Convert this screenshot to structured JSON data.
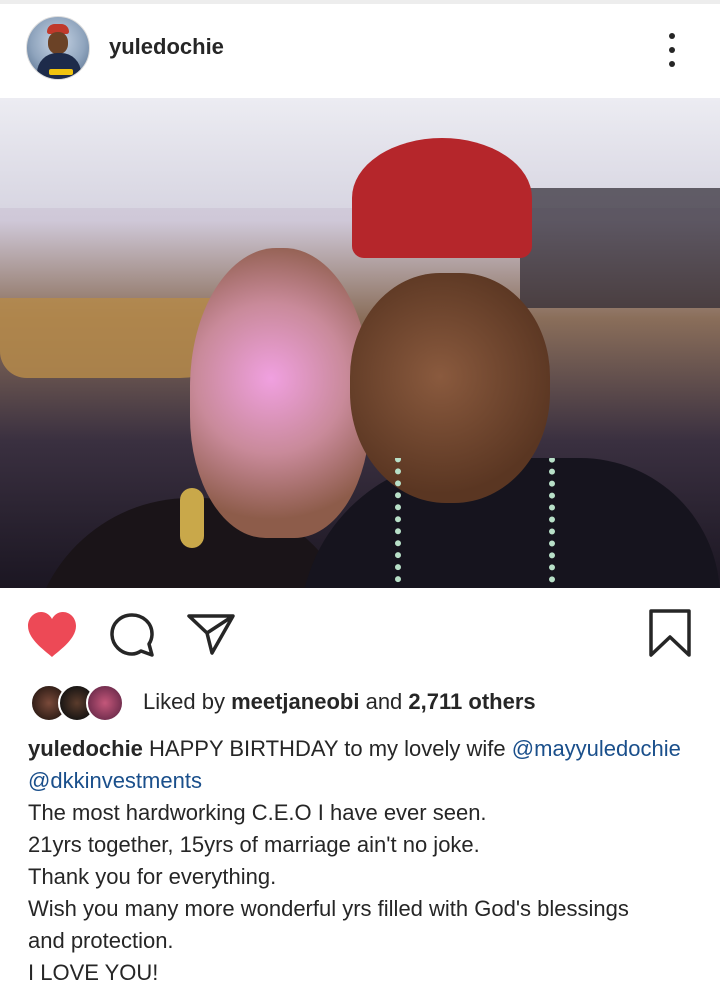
{
  "post": {
    "username": "yuledochie",
    "avatar_icon": "profile-avatar",
    "more_icon": "more-options-icon"
  },
  "actions": {
    "liked": true,
    "like_color": "#ed4956",
    "icons": [
      "heart-icon",
      "comment-icon",
      "share-icon",
      "bookmark-icon"
    ]
  },
  "likes": {
    "prefix": "Liked by",
    "user": "meetjaneobi",
    "and": "and",
    "count": "2,711 others"
  },
  "caption": {
    "username": "yuledochie",
    "text_1": "HAPPY BIRTHDAY to my lovely wife",
    "mention_1": "@mayyuledochie",
    "mention_2": "@dkkinvestments",
    "lines": [
      "The most hardworking C.E.O I have ever seen.",
      "21yrs together, 15yrs of marriage ain't no joke.",
      "Thank you for everything.",
      "Wish you many more wonderful yrs filled with God's blessings",
      "and protection.",
      "I LOVE YOU!"
    ],
    "mention_color": "#1a4f8b"
  }
}
